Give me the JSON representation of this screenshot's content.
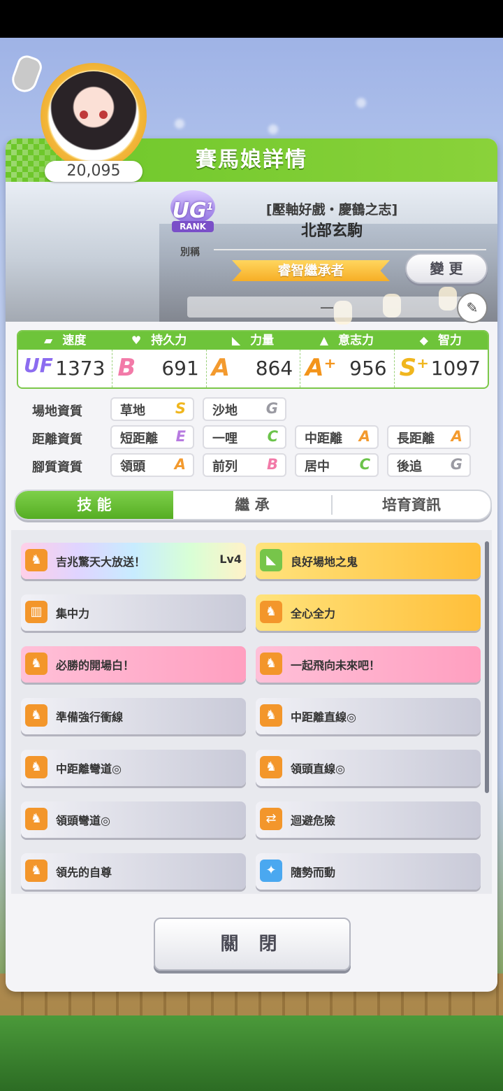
{
  "panel": {
    "title": "賽馬娘詳情"
  },
  "profile": {
    "fans": "20,095",
    "rank_badge": "UG",
    "rank_badge_sub": "1",
    "rank_text": "RANK",
    "alias_label": "別稱",
    "costume": "[壓軸好戲・慶鶴之志]",
    "name": "北部玄駒",
    "title_banner": "睿智繼承者",
    "change_button": "變 更",
    "memo": "—"
  },
  "stats": [
    {
      "label": "速度",
      "icon": "shoe-icon",
      "grade": "UF",
      "value": "1373"
    },
    {
      "label": "持久力",
      "icon": "heart-icon",
      "grade": "B",
      "value": "691"
    },
    {
      "label": "力量",
      "icon": "muscle-icon",
      "grade": "A",
      "value": "864"
    },
    {
      "label": "意志力",
      "icon": "flame-icon",
      "grade": "A⁺",
      "value": "956"
    },
    {
      "label": "智力",
      "icon": "graduation-cap-icon",
      "grade": "S⁺",
      "value": "1097"
    }
  ],
  "aptitude": {
    "track_label": "場地資質",
    "distance_label": "距離資質",
    "style_label": "腳質資質",
    "track": [
      {
        "name": "草地",
        "grade": "S"
      },
      {
        "name": "沙地",
        "grade": "G"
      }
    ],
    "distance": [
      {
        "name": "短距離",
        "grade": "E"
      },
      {
        "name": "一哩",
        "grade": "C"
      },
      {
        "name": "中距離",
        "grade": "A"
      },
      {
        "name": "長距離",
        "grade": "A"
      }
    ],
    "style": [
      {
        "name": "領頭",
        "grade": "A"
      },
      {
        "name": "前列",
        "grade": "B"
      },
      {
        "name": "居中",
        "grade": "C"
      },
      {
        "name": "後追",
        "grade": "G"
      }
    ]
  },
  "tabs": [
    "技 能",
    "繼 承",
    "培育資訊"
  ],
  "skills": [
    {
      "name": "吉兆驚天大放送！",
      "level": "Lv4",
      "style": "rainbow",
      "icon": "running-horse-icon"
    },
    {
      "name": "良好場地之鬼",
      "level": "",
      "style": "gold",
      "icon": "muscle-icon"
    },
    {
      "name": "集中力",
      "level": "",
      "style": "gray",
      "icon": "gate-icon"
    },
    {
      "name": "全心全力",
      "level": "",
      "style": "gold",
      "icon": "running-horse-icon"
    },
    {
      "name": "必勝的開場白！",
      "level": "",
      "style": "pink",
      "icon": "running-horse-icon"
    },
    {
      "name": "一起飛向未來吧！",
      "level": "",
      "style": "pink",
      "icon": "running-horse-icon"
    },
    {
      "name": "準備強行衝線",
      "level": "",
      "style": "gray",
      "icon": "running-horse-icon"
    },
    {
      "name": "中距離直線◎",
      "level": "",
      "style": "gray",
      "icon": "running-horse-icon"
    },
    {
      "name": "中距離彎道◎",
      "level": "",
      "style": "gray",
      "icon": "running-horse-icon"
    },
    {
      "name": "領頭直線◎",
      "level": "",
      "style": "gray",
      "icon": "running-horse-icon"
    },
    {
      "name": "領頭彎道◎",
      "level": "",
      "style": "gray",
      "icon": "running-horse-icon"
    },
    {
      "name": "迴避危險",
      "level": "",
      "style": "gray",
      "icon": "swap-arrows-icon"
    },
    {
      "name": "領先的自尊",
      "level": "",
      "style": "gray",
      "icon": "running-horse-icon"
    },
    {
      "name": "隨勢而動",
      "level": "",
      "style": "gray",
      "icon": "sparkle-icon"
    }
  ],
  "close_button": "關 閉"
}
